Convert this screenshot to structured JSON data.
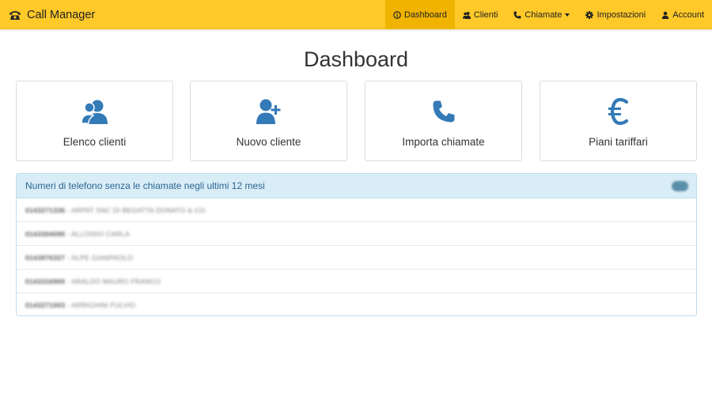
{
  "app": {
    "brand": "Call Manager"
  },
  "nav": {
    "items": [
      {
        "label": "Dashboard",
        "icon": "info-circle-icon",
        "active": true
      },
      {
        "label": "Clienti",
        "icon": "users-icon",
        "active": false
      },
      {
        "label": "Chiamate",
        "icon": "phone-icon",
        "active": false,
        "dropdown": true
      },
      {
        "label": "Impostazioni",
        "icon": "gear-icon",
        "active": false
      },
      {
        "label": "Account",
        "icon": "user-icon",
        "active": false
      }
    ]
  },
  "page": {
    "title": "Dashboard"
  },
  "tiles": [
    {
      "label": "Elenco clienti",
      "icon": "users-icon"
    },
    {
      "label": "Nuovo cliente",
      "icon": "add-user-icon"
    },
    {
      "label": "Importa chiamate",
      "icon": "phone-icon"
    },
    {
      "label": "Piani tariffari",
      "icon": "euro-icon"
    }
  ],
  "panel": {
    "title": "Numeri di telefono senza le chiamate negli ultimi 12 mesi",
    "badge": "",
    "rows": [
      {
        "number": "0143271336",
        "name": "ARPAT SNC DI BEGATTA DONATO & CO."
      },
      {
        "number": "0143304090",
        "name": "ALLOISIO CARLA"
      },
      {
        "number": "0143976327",
        "name": "ALPE GIANPAOLO"
      },
      {
        "number": "0143316900",
        "name": "ARALDO MAURO FRANCO"
      },
      {
        "number": "0143271003",
        "name": "ARRIGHINI FULVIO"
      }
    ]
  },
  "colors": {
    "navbar": "#ffc929",
    "navbar_active": "#f0b400",
    "icon_blue": "#337ab7",
    "panel_heading": "#d9edf7",
    "panel_title": "#2a6592"
  }
}
